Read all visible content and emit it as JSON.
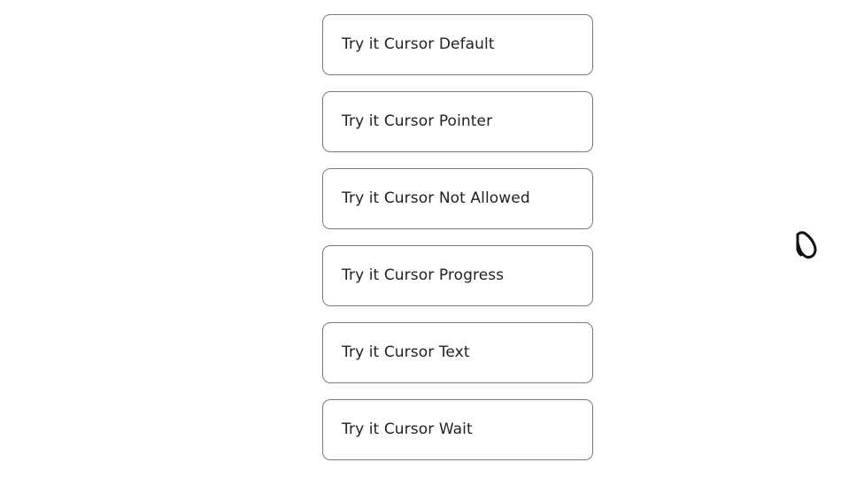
{
  "buttons": [
    {
      "label": "Try it Cursor Default"
    },
    {
      "label": "Try it Cursor Pointer"
    },
    {
      "label": "Try it Cursor Not Allowed"
    },
    {
      "label": "Try it Cursor Progress"
    },
    {
      "label": "Try it Cursor Text"
    },
    {
      "label": "Try it Cursor Wait"
    }
  ],
  "mouse_cursor": {
    "icon": "grab-hand-cursor-icon",
    "color": "#111111"
  }
}
